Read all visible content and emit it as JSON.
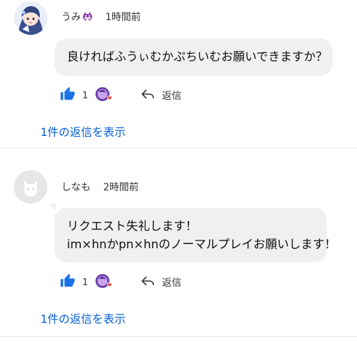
{
  "colors": {
    "link_blue": "#065fd4",
    "like_blue": "#1a73e8",
    "bubble_bg": "#f0f0f0",
    "divider": "#e6e6e6"
  },
  "comments": [
    {
      "author": "うみ",
      "author_emoji_icon": "alien-monster-icon",
      "time": "1時間前",
      "text_lines": [
        "良ければふうぃむかぷちいむお願いできますか？"
      ],
      "like_count": "1",
      "reply_label": "返信",
      "show_replies": "1件の返信を表示"
    },
    {
      "author": "しなも",
      "time": "2時間前",
      "text_lines": [
        "リクエスト失礼します！",
        "im×hnかpn×hnのノーマルプレイお願いします！"
      ],
      "like_count": "1",
      "reply_label": "返信",
      "show_replies": "1件の返信を表示"
    }
  ]
}
